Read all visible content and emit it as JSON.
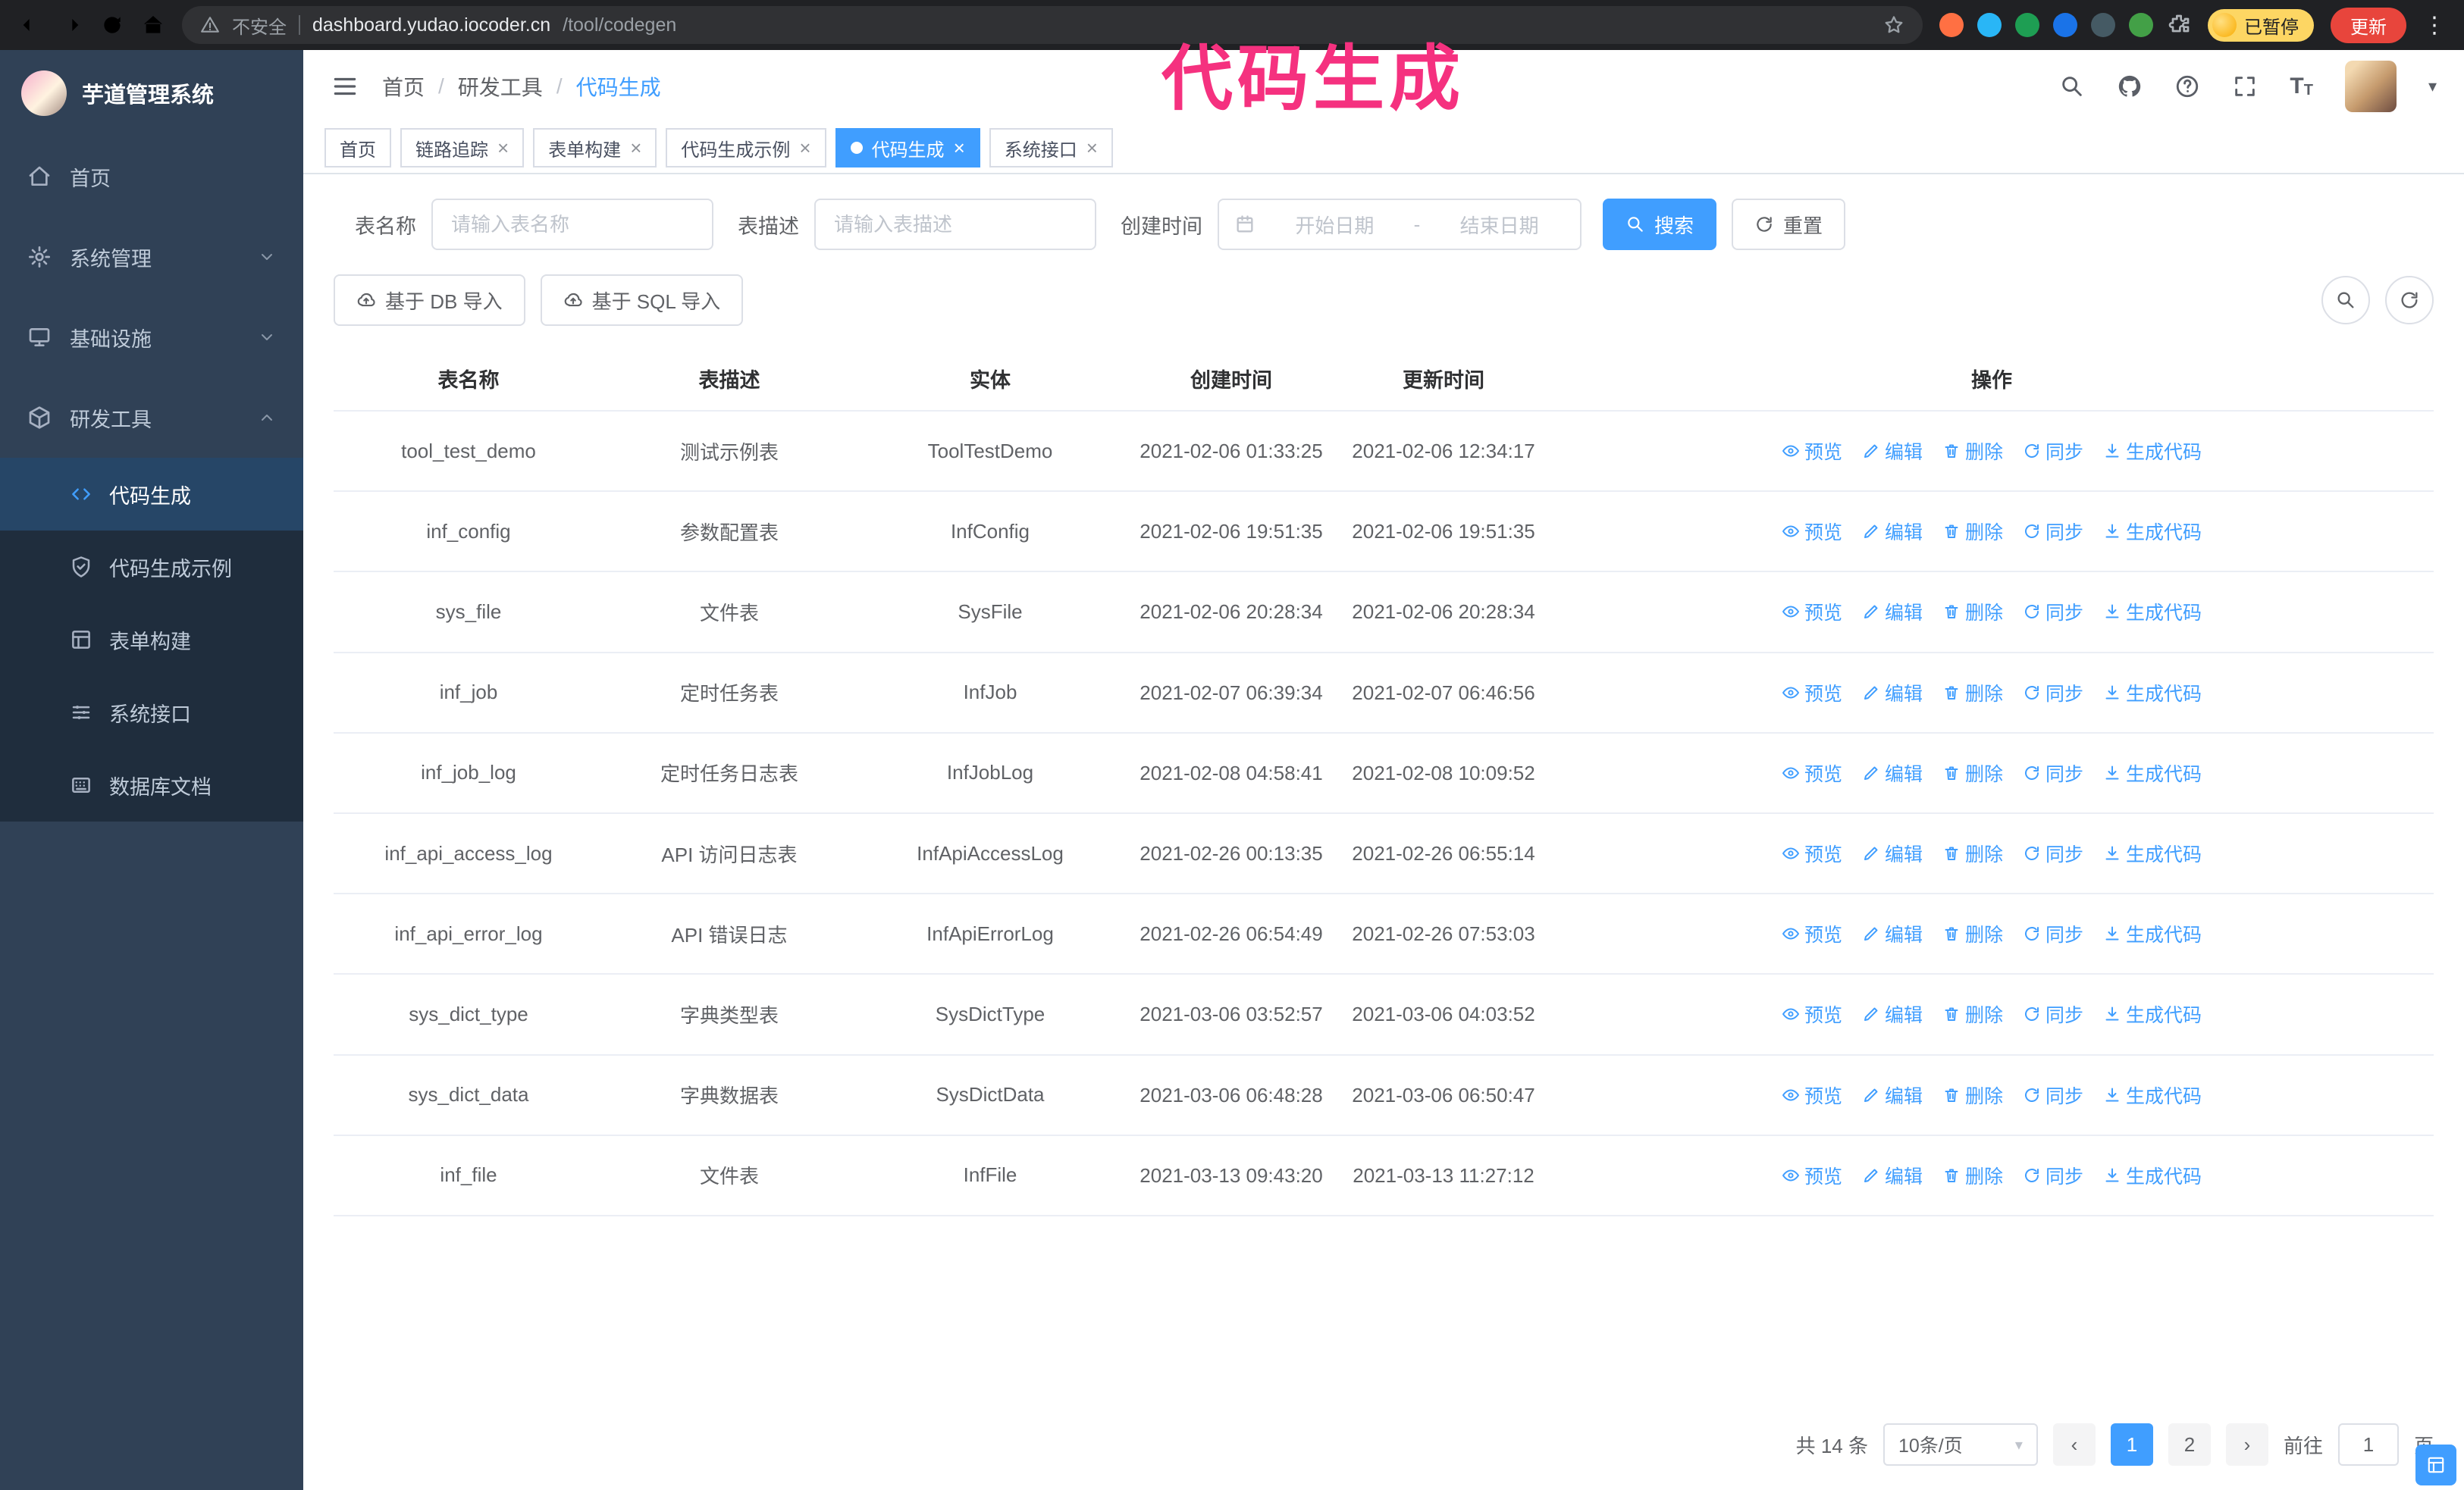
{
  "colors": {
    "accent": "#409eff",
    "annotation_pink": "#f5317f",
    "update_button_red": "#e8453c",
    "paused_badge_yellow": "#fdd663",
    "sidebar_bg": "#304156"
  },
  "annotation": {
    "text": "代码生成"
  },
  "browser": {
    "security_label": "不安全",
    "url_host": "dashboard.yudao.iocoder.cn",
    "url_path": "/tool/codegen",
    "paused_badge": "已暂停",
    "update_button": "更新"
  },
  "icons": {
    "close": "×",
    "caret_down": "▾",
    "kebab": "⋮",
    "prev": "‹",
    "next": "›",
    "separator": "/",
    "font_icon": "T"
  },
  "sidebar": {
    "logo_title": "芋道管理系统",
    "items": [
      {
        "label": "首页"
      },
      {
        "label": "系统管理"
      },
      {
        "label": "基础设施"
      },
      {
        "label": "研发工具"
      }
    ],
    "subitems": [
      {
        "label": "代码生成"
      },
      {
        "label": "代码生成示例"
      },
      {
        "label": "表单构建"
      },
      {
        "label": "系统接口"
      },
      {
        "label": "数据库文档"
      }
    ]
  },
  "header": {
    "breadcrumb": [
      "首页",
      "研发工具",
      "代码生成"
    ]
  },
  "tabs": [
    {
      "label": "首页"
    },
    {
      "label": "链路追踪"
    },
    {
      "label": "表单构建"
    },
    {
      "label": "代码生成示例"
    },
    {
      "label": "代码生成"
    },
    {
      "label": "系统接口"
    }
  ],
  "filters": {
    "name_label": "表名称",
    "name_placeholder": "请输入表名称",
    "desc_label": "表描述",
    "desc_placeholder": "请输入表描述",
    "time_label": "创建时间",
    "start_placeholder": "开始日期",
    "range_separator": "-",
    "end_placeholder": "结束日期",
    "search": "搜索",
    "reset": "重置"
  },
  "toolbar": {
    "import_db": "基于 DB 导入",
    "import_sql": "基于 SQL 导入"
  },
  "table": {
    "columns": [
      "表名称",
      "表描述",
      "实体",
      "创建时间",
      "更新时间",
      "操作"
    ],
    "actions": [
      "预览",
      "编辑",
      "删除",
      "同步",
      "生成代码"
    ],
    "rows": [
      {
        "name": "tool_test_demo",
        "desc": "测试示例表",
        "entity": "ToolTestDemo",
        "created": "2021-02-06 01:33:25",
        "updated": "2021-02-06 12:34:17"
      },
      {
        "name": "inf_config",
        "desc": "参数配置表",
        "entity": "InfConfig",
        "created": "2021-02-06 19:51:35",
        "updated": "2021-02-06 19:51:35"
      },
      {
        "name": "sys_file",
        "desc": "文件表",
        "entity": "SysFile",
        "created": "2021-02-06 20:28:34",
        "updated": "2021-02-06 20:28:34"
      },
      {
        "name": "inf_job",
        "desc": "定时任务表",
        "entity": "InfJob",
        "created": "2021-02-07 06:39:34",
        "updated": "2021-02-07 06:46:56"
      },
      {
        "name": "inf_job_log",
        "desc": "定时任务日志表",
        "entity": "InfJobLog",
        "created": "2021-02-08 04:58:41",
        "updated": "2021-02-08 10:09:52"
      },
      {
        "name": "inf_api_access_log",
        "desc": "API 访问日志表",
        "entity": "InfApiAccessLog",
        "created": "2021-02-26 00:13:35",
        "updated": "2021-02-26 06:55:14"
      },
      {
        "name": "inf_api_error_log",
        "desc": "API 错误日志",
        "entity": "InfApiErrorLog",
        "created": "2021-02-26 06:54:49",
        "updated": "2021-02-26 07:53:03"
      },
      {
        "name": "sys_dict_type",
        "desc": "字典类型表",
        "entity": "SysDictType",
        "created": "2021-03-06 03:52:57",
        "updated": "2021-03-06 04:03:52"
      },
      {
        "name": "sys_dict_data",
        "desc": "字典数据表",
        "entity": "SysDictData",
        "created": "2021-03-06 06:48:28",
        "updated": "2021-03-06 06:50:47"
      },
      {
        "name": "inf_file",
        "desc": "文件表",
        "entity": "InfFile",
        "created": "2021-03-13 09:43:20",
        "updated": "2021-03-13 11:27:12"
      }
    ]
  },
  "pagination": {
    "total": "共 14 条",
    "page_size": "10条/页",
    "pages": [
      "1",
      "2"
    ],
    "goto_label": "前往",
    "goto_value": "1",
    "goto_suffix": "页"
  }
}
